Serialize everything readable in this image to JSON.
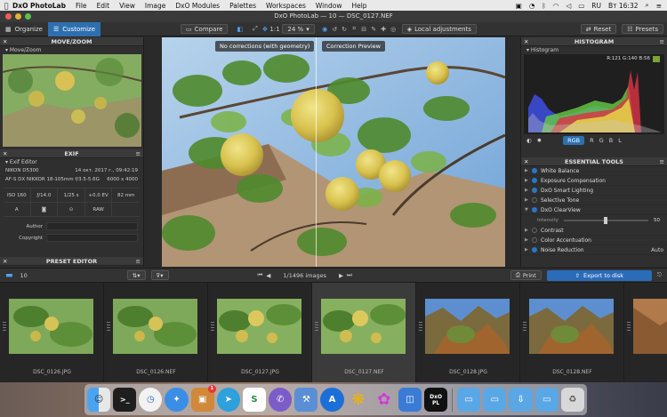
{
  "menubar": {
    "apple": "",
    "items": [
      "DxO PhotoLab",
      "File",
      "Edit",
      "View",
      "Image",
      "DxO Modules",
      "Palettes",
      "Workspaces",
      "Window",
      "Help"
    ],
    "lang": "RU",
    "clock": "Вт 16:32"
  },
  "window": {
    "title": "DxO PhotoLab — 10 — DSC_0127.NEF"
  },
  "toolbar": {
    "organize": "Organize",
    "customize": "Customize",
    "compare": "Compare",
    "one_to_one": "1:1",
    "zoom": "24 %",
    "local_adjustments": "Local adjustments",
    "reset": "Reset",
    "presets": "Presets"
  },
  "left": {
    "move_zoom_title": "MOVE/ZOOM",
    "move_zoom_sub": "Move/Zoom",
    "exif_title": "EXIF",
    "exif_sub": "Exif Editor",
    "camera": "NIKON D5300",
    "date": "14 окт. 2017 г., 09:42:19",
    "lens": "AF-S DX NIKKOR 18-105mm f/3.5-5.6G",
    "size": "6000 x 4000",
    "grid": [
      "ISO 160",
      "ƒ/14.0",
      "1/25 s",
      "+0.0 EV",
      "82 mm",
      "A",
      "◙",
      "⊙",
      "RAW",
      ""
    ],
    "author_label": "Author",
    "copyright_label": "Copyright",
    "preset_title": "PRESET EDITOR"
  },
  "viewer": {
    "left_label": "No corrections (with geometry)",
    "right_label": "Correction Preview"
  },
  "right": {
    "histogram_title": "HISTOGRAM",
    "histogram_sub": "Histogram",
    "readout": "R:121 G:140 B:56",
    "channels": [
      "RGB",
      "R",
      "G",
      "B",
      "L"
    ],
    "tools_title": "ESSENTIAL TOOLS",
    "tools": [
      {
        "label": "White Balance",
        "on": true,
        "val": ""
      },
      {
        "label": "Exposure Compensation",
        "on": true,
        "val": ""
      },
      {
        "label": "DxO Smart Lighting",
        "on": true,
        "val": ""
      },
      {
        "label": "Selective Tone",
        "on": false,
        "val": ""
      },
      {
        "label": "DxO ClearView",
        "on": true,
        "val": ""
      }
    ],
    "intensity_label": "Intensity",
    "intensity_value": "50",
    "intensity_level": 0.5,
    "tools2": [
      {
        "label": "Contrast",
        "on": false,
        "val": ""
      },
      {
        "label": "Color Accentuation",
        "on": false,
        "val": ""
      },
      {
        "label": "Noise Reduction",
        "on": true,
        "val": "Auto"
      }
    ]
  },
  "filmbar": {
    "folder_count": "10",
    "images_count": "1/1496 images",
    "print": "Print",
    "export": "Export to disk"
  },
  "thumbnails": [
    {
      "name": "DSC_0126.JPG",
      "selected": false
    },
    {
      "name": "DSC_0126.NEF",
      "selected": false
    },
    {
      "name": "DSC_0127.JPG",
      "selected": false
    },
    {
      "name": "DSC_0127.NEF",
      "selected": true
    },
    {
      "name": "DSC_0128.JPG",
      "selected": false
    },
    {
      "name": "DSC_0128.NEF",
      "selected": false
    },
    {
      "name": "",
      "selected": false
    }
  ],
  "dock": {
    "badge": "1",
    "dxo_label": "DxO\nPL"
  },
  "colors": {
    "accent": "#2e6fb0",
    "panel": "#2f2f2f",
    "export": "#2a6cb8"
  }
}
